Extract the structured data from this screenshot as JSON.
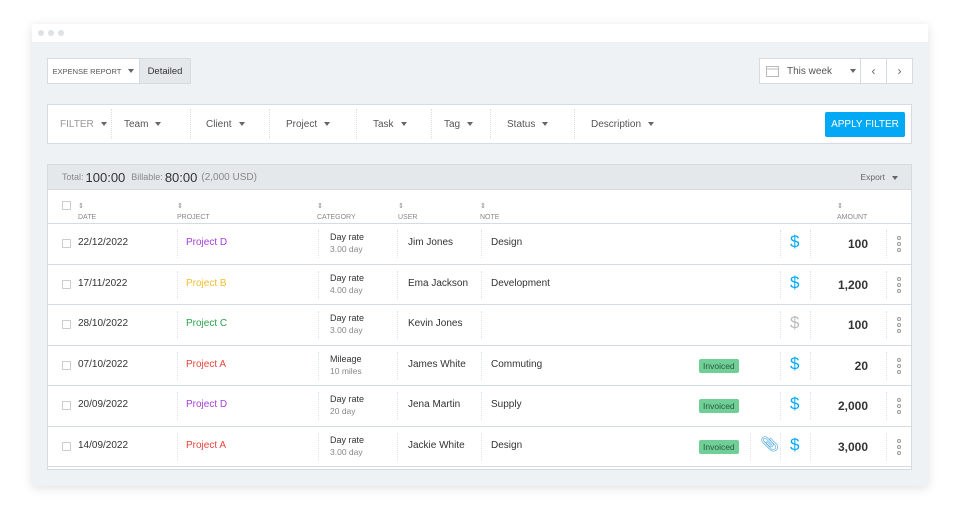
{
  "toolbar": {
    "report_label": "EXPENSE REPORT",
    "detailed_label": "Detailed",
    "range_label": "This week"
  },
  "filters": {
    "filter_label": "FILTER",
    "items": [
      "Team",
      "Client",
      "Project",
      "Task",
      "Tag",
      "Status",
      "Description"
    ],
    "apply_label": "APPLY FILTER"
  },
  "summary": {
    "total_label": "Total:",
    "total": "100:00",
    "billable_label": "Billable:",
    "billable": "80:00",
    "billable_amount": "(2,000 USD)",
    "export_label": "Export"
  },
  "columns": {
    "date": "DATE",
    "project": "PROJECT",
    "category": "CATEGORY",
    "user": "USER",
    "note": "NOTE",
    "amount": "AMOUNT"
  },
  "colors": {
    "accent": "#03a9f4",
    "project_d": "#a43fd9",
    "project_b": "#f2be2c",
    "project_c": "#2ea24a",
    "project_a": "#e8453c"
  },
  "rows": [
    {
      "date": "22/12/2022",
      "project": "Project D",
      "color": "#a43fd9",
      "category": "Day rate",
      "qty": "3.00 day",
      "user": "Jim Jones",
      "note": "Design",
      "status": "",
      "attach": false,
      "billable": true,
      "amount": "100"
    },
    {
      "date": "17/11/2022",
      "project": "Project B",
      "color": "#f2be2c",
      "category": "Day rate",
      "qty": "4.00 day",
      "user": "Ema Jackson",
      "note": "Development",
      "status": "",
      "attach": false,
      "billable": true,
      "amount": "1,200"
    },
    {
      "date": "28/10/2022",
      "project": "Project C",
      "color": "#2ea24a",
      "category": "Day rate",
      "qty": "3.00 day",
      "user": "Kevin Jones",
      "note": "",
      "status": "",
      "attach": false,
      "billable": false,
      "amount": "100"
    },
    {
      "date": "07/10/2022",
      "project": "Project A",
      "color": "#e8453c",
      "category": "Mileage",
      "qty": "10 miles",
      "user": "James White",
      "note": "Commuting",
      "status": "Invoiced",
      "attach": false,
      "billable": true,
      "amount": "20"
    },
    {
      "date": "20/09/2022",
      "project": "Project D",
      "color": "#a43fd9",
      "category": "Day rate",
      "qty": "20 day",
      "user": "Jena Martin",
      "note": "Supply",
      "status": "Invoiced",
      "attach": false,
      "billable": true,
      "amount": "2,000"
    },
    {
      "date": "14/09/2022",
      "project": "Project A",
      "color": "#e8453c",
      "category": "Day rate",
      "qty": "3.00 day",
      "user": "Jackie White",
      "note": "Design",
      "status": "Invoiced",
      "attach": true,
      "billable": true,
      "amount": "3,000"
    }
  ]
}
